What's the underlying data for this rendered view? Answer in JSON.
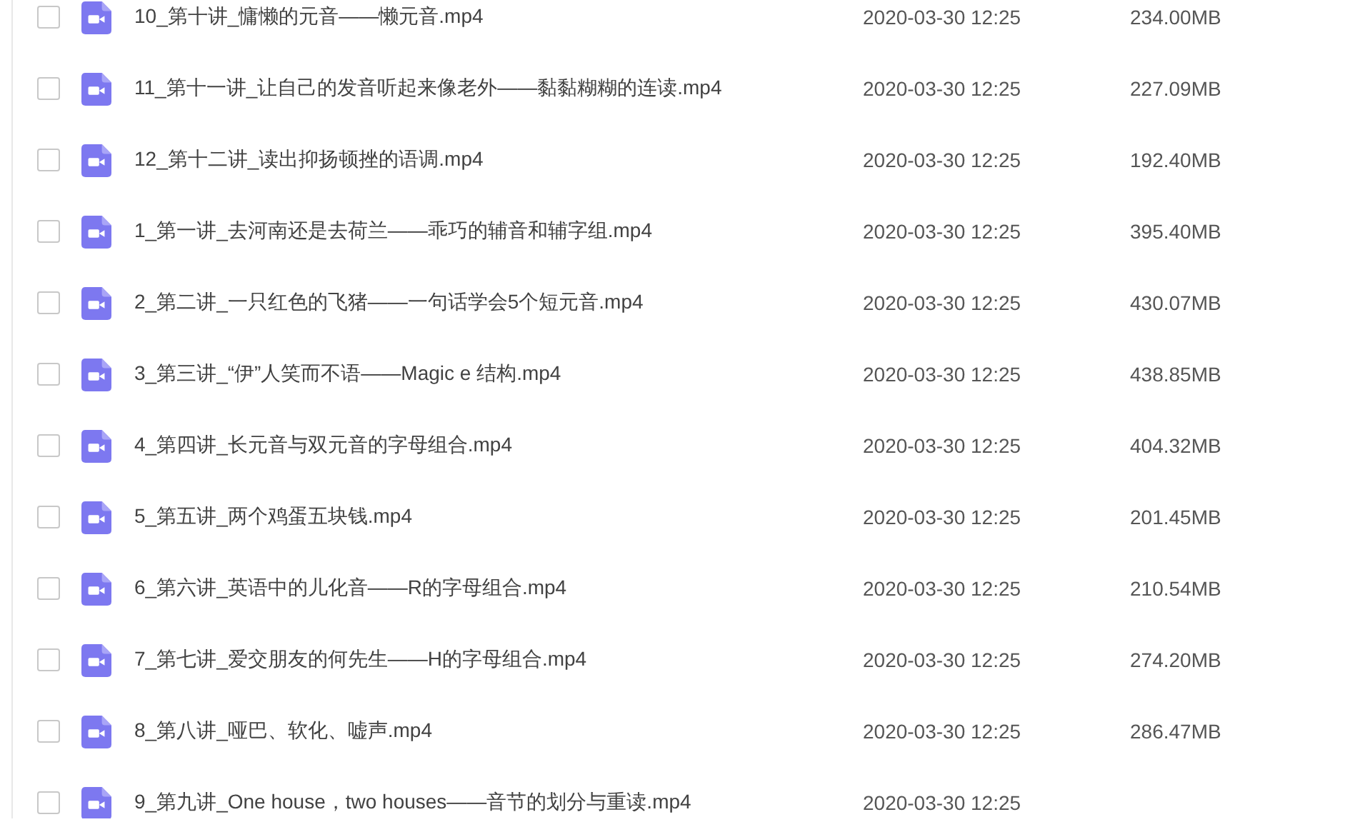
{
  "files": [
    {
      "name": "10_第十讲_慵懒的元音——懒元音.mp4",
      "modified": "2020-03-30 12:25",
      "size": "234.00MB",
      "checked": false
    },
    {
      "name": "11_第十一讲_让自己的发音听起来像老外——黏黏糊糊的连读.mp4",
      "modified": "2020-03-30 12:25",
      "size": "227.09MB",
      "checked": false
    },
    {
      "name": "12_第十二讲_读出抑扬顿挫的语调.mp4",
      "modified": "2020-03-30 12:25",
      "size": "192.40MB",
      "checked": false
    },
    {
      "name": "1_第一讲_去河南还是去荷兰——乖巧的辅音和辅字组.mp4",
      "modified": "2020-03-30 12:25",
      "size": "395.40MB",
      "checked": false
    },
    {
      "name": "2_第二讲_一只红色的飞猪——一句话学会5个短元音.mp4",
      "modified": "2020-03-30 12:25",
      "size": "430.07MB",
      "checked": false
    },
    {
      "name": "3_第三讲_“伊”人笑而不语——Magic e 结构.mp4",
      "modified": "2020-03-30 12:25",
      "size": "438.85MB",
      "checked": false
    },
    {
      "name": "4_第四讲_长元音与双元音的字母组合.mp4",
      "modified": "2020-03-30 12:25",
      "size": "404.32MB",
      "checked": false
    },
    {
      "name": "5_第五讲_两个鸡蛋五块钱.mp4",
      "modified": "2020-03-30 12:25",
      "size": "201.45MB",
      "checked": false
    },
    {
      "name": "6_第六讲_英语中的儿化音——R的字母组合.mp4",
      "modified": "2020-03-30 12:25",
      "size": "210.54MB",
      "checked": false
    },
    {
      "name": "7_第七讲_爱交朋友的何先生——H的字母组合.mp4",
      "modified": "2020-03-30 12:25",
      "size": "274.20MB",
      "checked": false
    },
    {
      "name": "8_第八讲_哑巴、软化、嘘声.mp4",
      "modified": "2020-03-30 12:25",
      "size": "286.47MB",
      "checked": false
    },
    {
      "name": "9_第九讲_One house，two houses——音节的划分与重读.mp4",
      "modified": "2020-03-30 12:25",
      "checked": false
    }
  ]
}
